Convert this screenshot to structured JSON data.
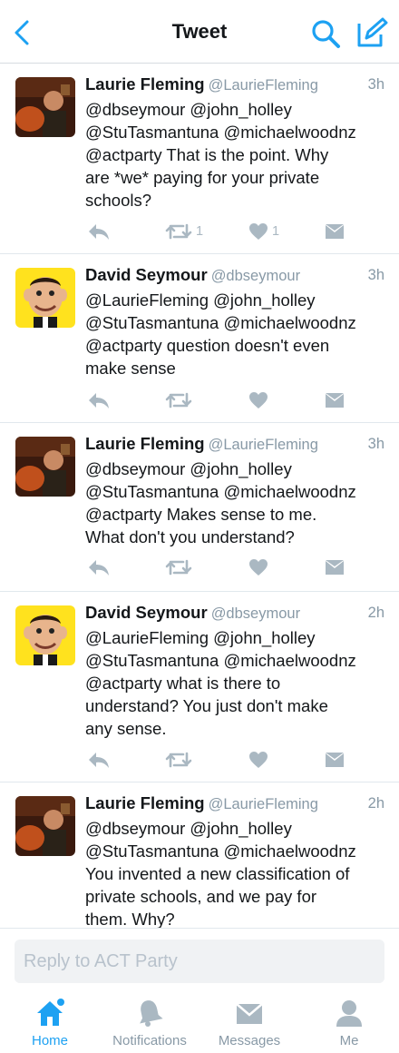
{
  "header": {
    "title": "Tweet",
    "back_icon": "chevron-left-icon",
    "search_icon": "search-icon",
    "compose_icon": "compose-icon",
    "accent": "#1da1f2"
  },
  "tweets": [
    {
      "author": "Laurie Fleming",
      "handle": "@LaurieFleming",
      "time": "3h",
      "text": "@dbseymour @john_holley\n@StuTasmantuna @michaelwoodnz\n@actparty That is the point. Why\nare *we* paying for your private\nschools?",
      "retweets": "1",
      "likes": "1"
    },
    {
      "author": "David Seymour",
      "handle": "@dbseymour",
      "time": "3h",
      "text": "@LaurieFleming @john_holley\n@StuTasmantuna @michaelwoodnz\n@actparty question doesn't even\nmake sense",
      "retweets": "",
      "likes": ""
    },
    {
      "author": "Laurie Fleming",
      "handle": "@LaurieFleming",
      "time": "3h",
      "text": "@dbseymour @john_holley\n@StuTasmantuna @michaelwoodnz\n@actparty Makes sense to me.\nWhat don't you understand?",
      "retweets": "",
      "likes": ""
    },
    {
      "author": "David Seymour",
      "handle": "@dbseymour",
      "time": "2h",
      "text": "@LaurieFleming @john_holley\n@StuTasmantuna @michaelwoodnz\n@actparty what is there to\nunderstand?  You just don't make\nany sense.",
      "retweets": "",
      "likes": ""
    },
    {
      "author": "Laurie Fleming",
      "handle": "@LaurieFleming",
      "time": "2h",
      "text": "@dbseymour @john_holley\n@StuTasmantuna @michaelwoodnz\nYou invented a new classification of\nprivate schools, and we pay for\nthem. Why?",
      "retweets": "",
      "likes": ""
    }
  ],
  "reply": {
    "placeholder": "Reply to ACT Party"
  },
  "tabs": [
    {
      "label": "Home",
      "icon": "home-icon",
      "active": true
    },
    {
      "label": "Notifications",
      "icon": "bell-icon",
      "active": false
    },
    {
      "label": "Messages",
      "icon": "envelope-icon",
      "active": false
    },
    {
      "label": "Me",
      "icon": "person-icon",
      "active": false
    }
  ]
}
